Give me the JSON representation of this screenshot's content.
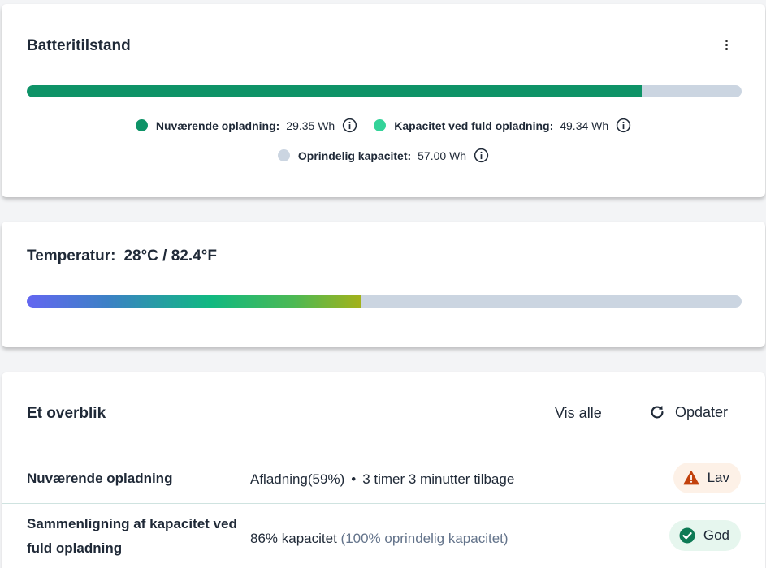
{
  "battery": {
    "title": "Batteritilstand",
    "menu_icon": "kebab-vertical-icon",
    "charge_fraction": 0.8604,
    "colors": {
      "current": "#0e9367",
      "full": "#34d399",
      "original": "#cbd5e1"
    },
    "legend": {
      "current_label": "Nuværende opladning:",
      "current_value": "29.35 Wh",
      "full_label": "Kapacitet ved fuld opladning:",
      "full_value": "49.34 Wh",
      "original_label": "Oprindelig kapacitet:",
      "original_value": "57.00 Wh"
    }
  },
  "temperature": {
    "label": "Temperatur:",
    "value": "28°C / 82.4°F",
    "fill_fraction": 0.4665
  },
  "overview": {
    "title": "Et overblik",
    "view_all": "Vis alle",
    "refresh_label": "Opdater",
    "refresh_icon": "refresh-icon",
    "rows": [
      {
        "label": "Nuværende opladning",
        "value_main": "Afladning(59%)",
        "separator": "•",
        "value_extra": "3 timer 3 minutter tilbage",
        "badge": "Lav",
        "badge_icon": "warning-triangle-icon",
        "badge_color": "#c2410c"
      },
      {
        "label": "Sammenligning af kapacitet ved fuld opladning",
        "value_main": "86% kapacitet",
        "value_extra": "(100% oprindelig kapacitet)",
        "badge": "God",
        "badge_icon": "check-circle-icon",
        "badge_color": "#0e7a55"
      }
    ]
  }
}
